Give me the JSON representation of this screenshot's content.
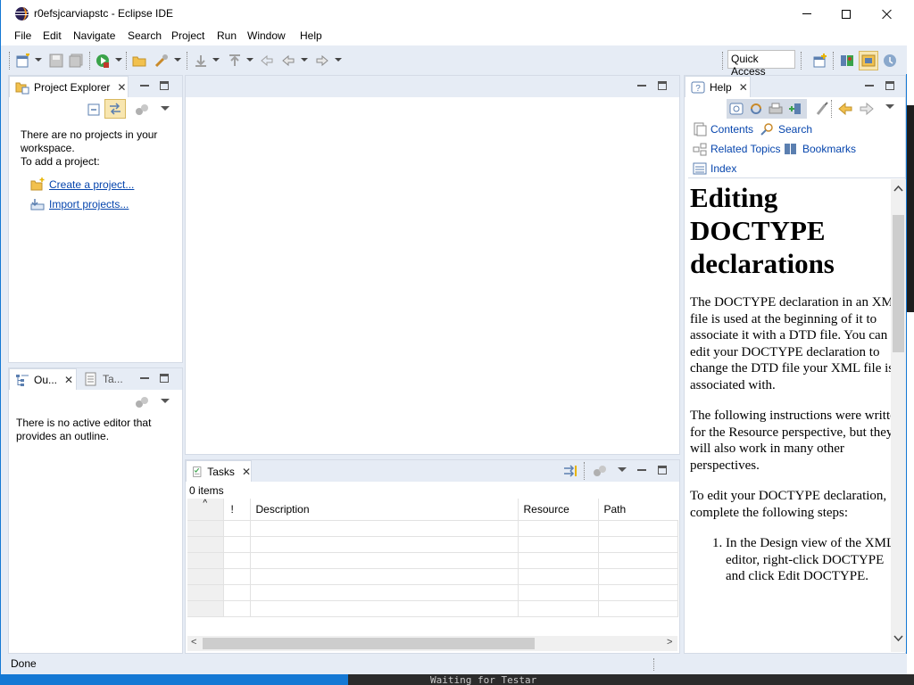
{
  "window": {
    "title": "r0efsjcarviapstc - Eclipse IDE"
  },
  "menubar": {
    "items": [
      "File",
      "Edit",
      "Navigate",
      "Search",
      "Project",
      "Run",
      "Window",
      "Help"
    ]
  },
  "toolbar": {
    "quick_access": "Quick Access"
  },
  "project_explorer": {
    "tab_label": "Project Explorer",
    "empty_line1": "There are no projects in your",
    "empty_line2": "workspace.",
    "empty_line3": "To add a project:",
    "create_link": "Create a project...",
    "import_link": "Import projects..."
  },
  "outline": {
    "tab_label": "Ou...",
    "tasks_tab_label": "Ta...",
    "empty_line1": "There is no active editor that",
    "empty_line2": "provides an outline."
  },
  "tasks": {
    "tab_label": "Tasks",
    "count": "0 items",
    "columns": [
      "!",
      "Description",
      "Resource",
      "Path"
    ]
  },
  "help": {
    "tab_label": "Help",
    "nav": {
      "contents": "Contents",
      "search": "Search",
      "related": "Related Topics",
      "bookmarks": "Bookmarks",
      "index": "Index"
    },
    "heading": "Editing DOCTYPE declarations",
    "para1": "The DOCTYPE declaration in an XML file is used at the beginning of it to associate it with a DTD file. You can edit your DOCTYPE declaration to change the DTD file your XML file is associated with.",
    "para2": "The following instructions were written for the Resource perspective, but they will also work in many other perspectives.",
    "para3": "To edit your DOCTYPE declaration, complete the following steps:",
    "step1": "In the Design view of the XML editor, right-click DOCTYPE and click Edit DOCTYPE."
  },
  "status": {
    "text": "Done"
  },
  "background": {
    "terminal_text": "Waiting for Testar"
  }
}
